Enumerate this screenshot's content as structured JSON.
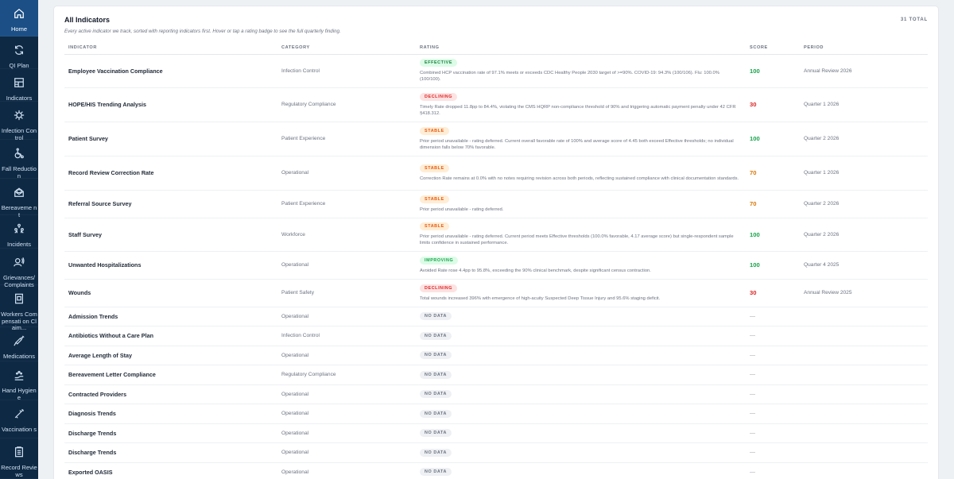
{
  "sidebar": {
    "items": [
      {
        "label": "Home",
        "icon": "home-icon",
        "active": true
      },
      {
        "label": "QI Plan",
        "icon": "refresh-icon"
      },
      {
        "label": "Indicators",
        "icon": "grid-icon"
      },
      {
        "label": "Infection Control",
        "icon": "virus-icon"
      },
      {
        "label": "Fall Reduction",
        "icon": "wheelchair-icon"
      },
      {
        "label": "Bereaveme nt",
        "icon": "mail-open-icon"
      },
      {
        "label": "Incidents",
        "icon": "people-network-icon"
      },
      {
        "label": "Grievances/ Complaints",
        "icon": "speaking-person-icon"
      },
      {
        "label": "Workers Compensati on Claim...",
        "icon": "document-icon"
      },
      {
        "label": "Medications",
        "icon": "syringe-icon"
      },
      {
        "label": "Hand Hygiene",
        "icon": "hand-wash-icon"
      },
      {
        "label": "Vaccination s",
        "icon": "needle-icon"
      },
      {
        "label": "Record Reviews",
        "icon": "clipboard-icon"
      }
    ]
  },
  "card": {
    "title": "All Indicators",
    "subtitle": "Every active indicator we track, sorted with reporting indicators first. Hover or tap a rating badge to see the full quarterly finding.",
    "total": "31 TOTAL"
  },
  "table": {
    "headers": {
      "indicator": "INDICATOR",
      "category": "CATEGORY",
      "rating": "RATING",
      "score": "SCORE",
      "period": "PERIOD"
    },
    "rows": [
      {
        "name": "Employee Vaccination Compliance",
        "category": "Infection Control",
        "rating": "EFFECTIVE",
        "rating_type": "effective",
        "finding": "Combined HCP vaccination rate of 97.1% meets or exceeds CDC Healthy People 2030 target of >=90%. COVID-19: 94.3% (100/106). Flu: 100.0% (100/100).",
        "score": "100",
        "score_color": "green",
        "period": "Annual Review 2026",
        "h": 42
      },
      {
        "name": "HOPE/HIS Trending Analysis",
        "category": "Regulatory Compliance",
        "rating": "DECLINING",
        "rating_type": "declining",
        "finding": "Timely Rate dropped 11.8pp to 84.4%, violating the CMS HQRP non-compliance threshold of 90% and triggering automatic payment penalty under 42 CFR §418.312.",
        "score": "30",
        "score_color": "red",
        "period": "Quarter 1 2026",
        "h": 43
      },
      {
        "name": "Patient Survey",
        "category": "Patient Experience",
        "rating": "STABLE",
        "rating_type": "stable",
        "finding": "Prior period unavailable - rating deferred. Current overall favorable rate of 100% and average score of 4.45 both exceed Effective thresholds; no individual dimension falls below 70% favorable.",
        "score": "100",
        "score_color": "green",
        "period": "Quarter 2 2026",
        "h": 43
      },
      {
        "name": "Record Review Correction Rate",
        "category": "Operational",
        "rating": "STABLE",
        "rating_type": "stable",
        "finding": "Correction Rate remains at 0.0% with no notes requiring revision across both periods, reflecting sustained compliance with clinical documentation standards.",
        "score": "70",
        "score_color": "orange",
        "period": "Quarter 1 2026",
        "h": 43
      },
      {
        "name": "Referral Source Survey",
        "category": "Patient Experience",
        "rating": "STABLE",
        "rating_type": "stable",
        "finding": "Prior period unavailable - rating deferred.",
        "score": "70",
        "score_color": "orange",
        "period": "Quarter 2 2026",
        "h": 35
      },
      {
        "name": "Staff Survey",
        "category": "Workforce",
        "rating": "STABLE",
        "rating_type": "stable",
        "finding": "Prior period unavailable - rating deferred. Current period meets Effective thresholds (100.0% favorable, 4.17 average score) but single-respondent sample limits confidence in sustained performance.",
        "score": "100",
        "score_color": "green",
        "period": "Quarter 2 2026",
        "h": 42
      },
      {
        "name": "Unwanted Hospitalizations",
        "category": "Operational",
        "rating": "IMPROVING",
        "rating_type": "improving",
        "finding": "Avoided Rate rose 4.4pp to 95.8%, exceeding the 90% clinical benchmark, despite significant census contraction.",
        "score": "100",
        "score_color": "green",
        "period": "Quarter 4 2025",
        "h": 35
      },
      {
        "name": "Wounds",
        "category": "Patient Safety",
        "rating": "DECLINING",
        "rating_type": "declining",
        "finding": "Total wounds increased 396% with emergence of high-acuity Suspected Deep Tissue Injury and 95.6% staging deficit.",
        "score": "30",
        "score_color": "red",
        "period": "Annual Review 2025",
        "h": 35
      },
      {
        "name": "Admission Trends",
        "category": "Operational",
        "rating": "NO DATA",
        "rating_type": "nodata",
        "finding": "",
        "score": "—",
        "score_color": "dash",
        "period": "",
        "h": 24
      },
      {
        "name": "Antibiotics Without a Care Plan",
        "category": "Infection Control",
        "rating": "NO DATA",
        "rating_type": "nodata",
        "finding": "",
        "score": "—",
        "score_color": "dash",
        "period": "",
        "h": 25
      },
      {
        "name": "Average Length of Stay",
        "category": "Operational",
        "rating": "NO DATA",
        "rating_type": "nodata",
        "finding": "",
        "score": "—",
        "score_color": "dash",
        "period": "",
        "h": 24
      },
      {
        "name": "Bereavement Letter Compliance",
        "category": "Regulatory Compliance",
        "rating": "NO DATA",
        "rating_type": "nodata",
        "finding": "",
        "score": "—",
        "score_color": "dash",
        "period": "",
        "h": 25
      },
      {
        "name": "Contracted Providers",
        "category": "Operational",
        "rating": "NO DATA",
        "rating_type": "nodata",
        "finding": "",
        "score": "—",
        "score_color": "dash",
        "period": "",
        "h": 24
      },
      {
        "name": "Diagnosis Trends",
        "category": "Operational",
        "rating": "NO DATA",
        "rating_type": "nodata",
        "finding": "",
        "score": "—",
        "score_color": "dash",
        "period": "",
        "h": 25
      },
      {
        "name": "Discharge Trends",
        "category": "Operational",
        "rating": "NO DATA",
        "rating_type": "nodata",
        "finding": "",
        "score": "—",
        "score_color": "dash",
        "period": "",
        "h": 24
      },
      {
        "name": "Discharge Trends",
        "category": "Operational",
        "rating": "NO DATA",
        "rating_type": "nodata",
        "finding": "",
        "score": "—",
        "score_color": "dash",
        "period": "",
        "h": 25
      },
      {
        "name": "Exported OASIS",
        "category": "Operational",
        "rating": "NO DATA",
        "rating_type": "nodata",
        "finding": "",
        "score": "—",
        "score_color": "dash",
        "period": "",
        "h": 24
      }
    ]
  },
  "colors": {
    "sidebar_bg": "#0e2944",
    "sidebar_active": "#1b4f86",
    "score_green": "#16a34a",
    "score_red": "#dc2626",
    "score_orange": "#d97706"
  }
}
